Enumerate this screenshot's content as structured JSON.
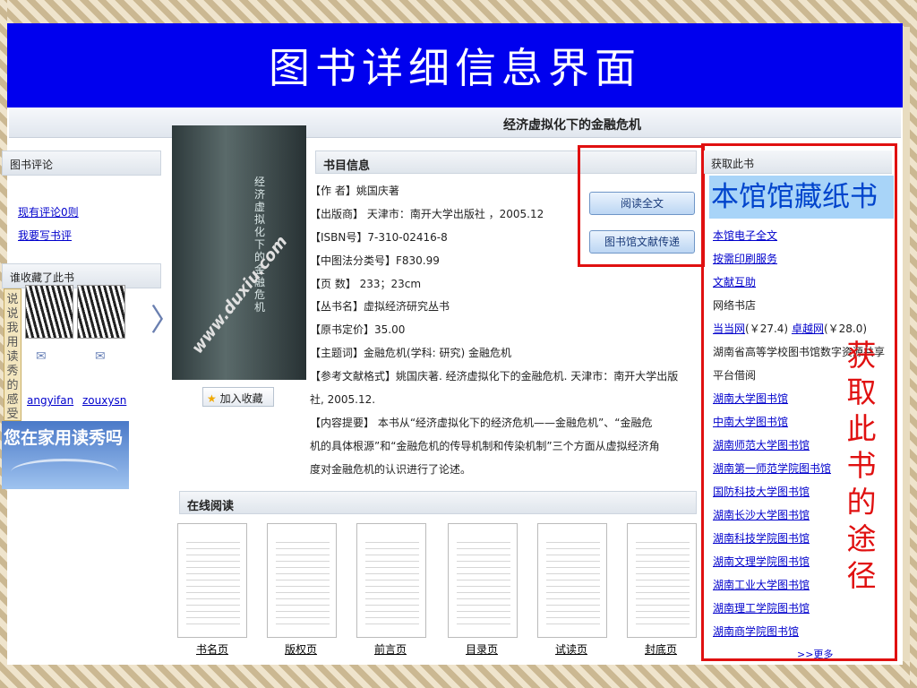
{
  "slide_title": "图书详细信息界面",
  "book_title": "经济虚拟化下的金融危机",
  "left": {
    "review_head": "图书评论",
    "review_count_link": "现有评论0则",
    "write_review_link": "我要写书评",
    "collectors_head": "谁收藏了此书",
    "users": [
      "angyifan",
      "zouxysn"
    ],
    "side_tab": "说说我用读秀的感受",
    "promo": "您在家用读秀吗"
  },
  "cover": {
    "title": "经济虚拟化下的金融危机",
    "watermark": "www.duxiu.com",
    "favorite_button": "加入收藏"
  },
  "info": {
    "head": "书目信息",
    "lines": [
      "【作 者】姚国庆著",
      "【出版商】 天津市：南开大学出版社 ，2005.12",
      "【ISBN号】7-310-02416-8",
      "【中图法分类号】F830.99",
      "【页 数】 233；23cm",
      "【丛书名】虚拟经济研究丛书",
      "【原书定价】35.00",
      "【主题词】金融危机(学科: 研究) 金融危机",
      "【参考文献格式】姚国庆著. 经济虚拟化下的金融危机. 天津市：南开大学出版",
      "社, 2005.12.",
      "【内容提要】 本书从“经济虚拟化下的经济危机——金融危机”、“金融危",
      "机的具体根源”和“金融危机的传导机制和传染机制”三个方面从虚拟经济角",
      "度对金融危机的认识进行了论述。"
    ],
    "read_full_button": "阅读全文",
    "doc_delivery_button": "图书馆文献传递"
  },
  "online": {
    "head": "在线阅读",
    "pages": [
      "书名页",
      "版权页",
      "前言页",
      "目录页",
      "试读页",
      "封底页"
    ]
  },
  "acquire": {
    "head": "获取此书",
    "paper_copy": "本馆馆藏纸书",
    "ebook_link": "本馆电子全文",
    "print_link": "按需印刷服务",
    "mutual_link": "文献互助",
    "online_store": "网络书店",
    "dangdang": "当当网",
    "dangdang_price": "(￥27.4)",
    "joyo": "卓越网",
    "joyo_price": "(￥28.0)",
    "platform": "湖南省高等学校图书馆数字资源共享",
    "platform2": "平台借阅",
    "libraries": [
      "湖南大学图书馆",
      "中南大学图书馆",
      "湖南师范大学图书馆",
      "湖南第一师范学院图书馆",
      "国防科技大学图书馆",
      "湖南长沙大学图书馆",
      "湖南科技学院图书馆",
      "湖南文理学院图书馆",
      "湖南工业大学图书馆",
      "湖南理工学院图书馆",
      "湖南商学院图书馆"
    ],
    "more": ">>更多",
    "annotation": "获取此书的途径"
  }
}
